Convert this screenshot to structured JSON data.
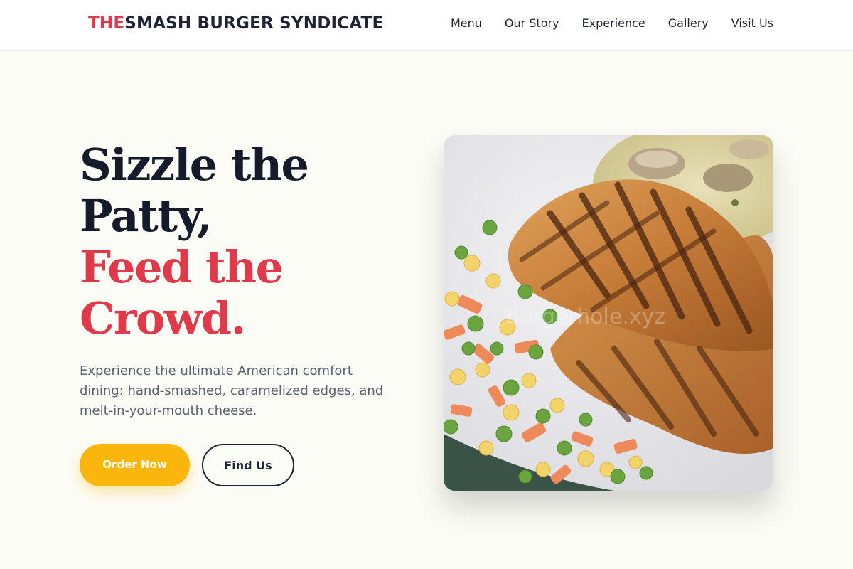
{
  "navbar": {
    "brand_accent": "THE",
    "brand_rest": "SMASH BURGER SYNDICATE",
    "links": [
      "Menu",
      "Our Story",
      "Experience",
      "Gallery",
      "Visit Us"
    ]
  },
  "hero": {
    "headline_line1": "Sizzle the",
    "headline_line2": "Patty,",
    "headline_line3": "Feed the",
    "headline_line4": "Crowd.",
    "subtitle": "Experience the ultimate American comfort dining: hand-smashed, caramelized edges, and melt-in-your-mouth cheese.",
    "primary_button": "Order Now",
    "secondary_button": "Find Us",
    "image_watermark": "burgerhole.xyz"
  },
  "colors": {
    "accent_red": "#e0394a",
    "primary_yellow": "#fbb60e",
    "dark_text": "#1e2433",
    "page_background": "#fcfcf6"
  }
}
